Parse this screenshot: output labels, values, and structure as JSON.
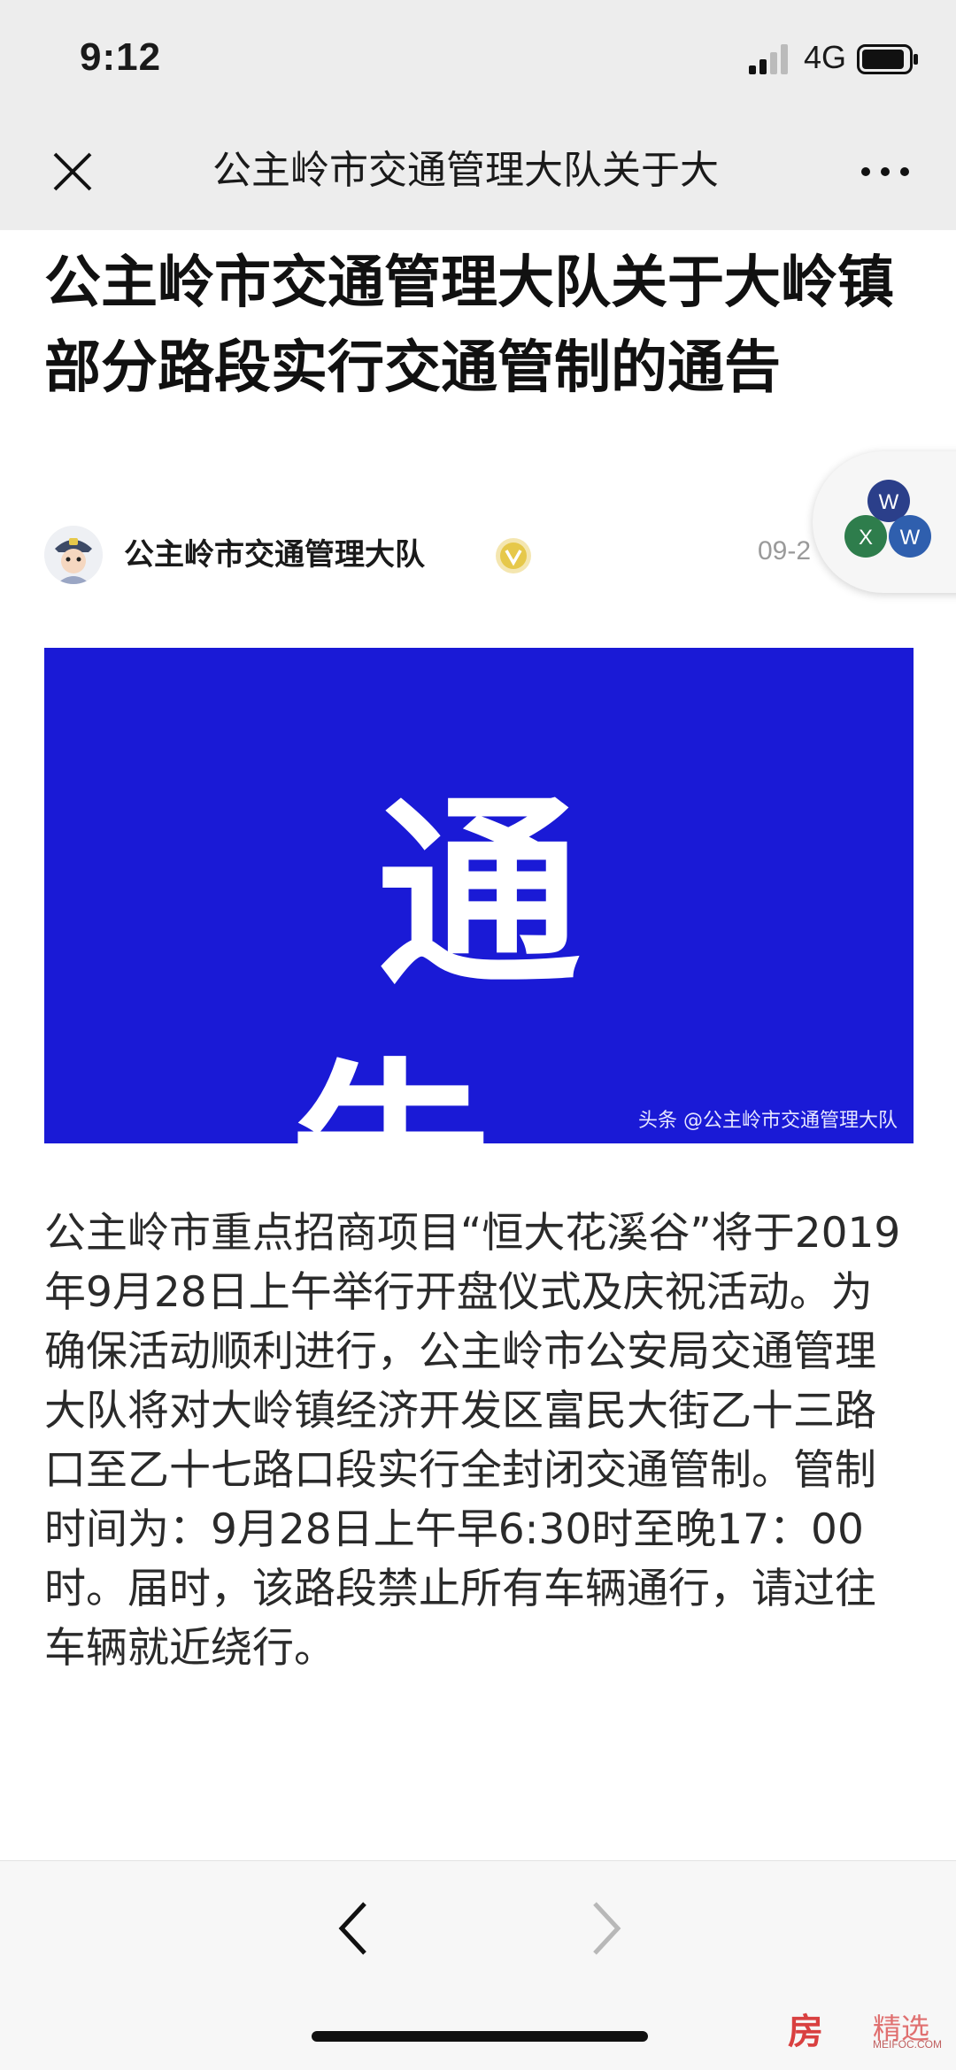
{
  "status_bar": {
    "time": "9:12",
    "network": "4G"
  },
  "title_bar": {
    "title": "公主岭市交通管理大队关于大"
  },
  "article": {
    "title": "公主岭市交通管理大队关于大岭镇部分路段实行交通管制的通告",
    "author": "公主岭市交通管理大队",
    "publish_date": "09-2",
    "banner_text": "通告",
    "banner_watermark": "头条 @公主岭市交通管理大队",
    "body": "公主岭市重点招商项目“恒大花溪谷”将于2019年9月28日上午举行开盘仪式及庆祝活动。为确保活动顺利进行，公主岭市公安局交通管理大队将对大岭镇经济开发区富民大街乙十三路口至乙十七路口段实行全封闭交通管制。管制时间为：9月28日上午早6:30时至晚17：00时。届时，该路段禁止所有车辆通行，请过往车辆就近绕行。"
  },
  "float_bubble": {
    "labels": [
      "W",
      "X",
      "W"
    ]
  },
  "watermark": {
    "brand": "房",
    "tag": "精选",
    "url": "MEIFOC.COM"
  },
  "icons": {
    "close": "close-icon",
    "more": "more-icon",
    "verified": "verified-icon",
    "back": "back-arrow-icon",
    "forward": "forward-arrow-icon"
  },
  "colors": {
    "banner_bg": "#1a1ad6",
    "chrome_bg": "#ededed",
    "verified": "#e6c84a"
  }
}
